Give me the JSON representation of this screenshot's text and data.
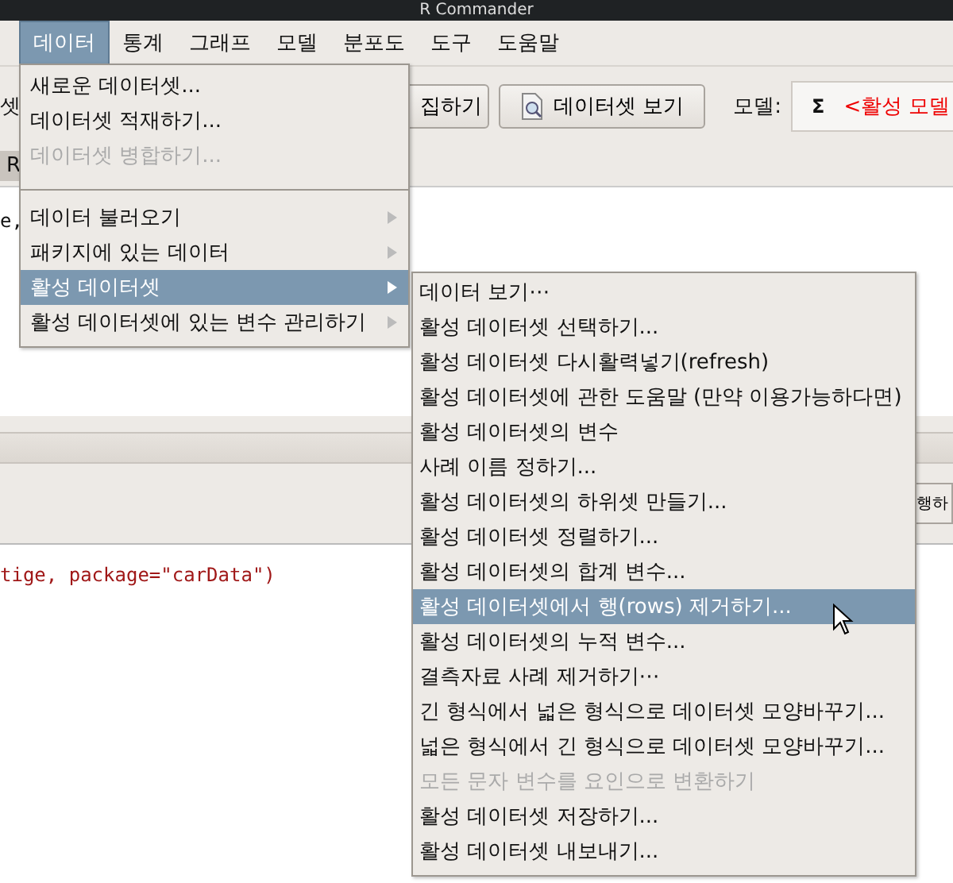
{
  "window": {
    "title": "R Commander"
  },
  "menubar": [
    {
      "label": "데이터",
      "selected": true
    },
    {
      "label": "통계",
      "selected": false
    },
    {
      "label": "그래프",
      "selected": false
    },
    {
      "label": "모델",
      "selected": false
    },
    {
      "label": "분포도",
      "selected": false
    },
    {
      "label": "도구",
      "selected": false
    },
    {
      "label": "도움말",
      "selected": false
    }
  ],
  "toolbar": {
    "left_label": "셋",
    "edit_button": "집하기",
    "view_button": "데이터셋 보기",
    "model_label": "모델:",
    "model_symbol": "Σ",
    "model_value": "<활성 모델"
  },
  "script_tab": "R",
  "script_lines": [
    "e,"
  ],
  "run_button": "행하",
  "output_lines": [
    "tige, package=\"carData\")"
  ],
  "data_menu": [
    {
      "kind": "item",
      "label": "새로운 데이터셋...",
      "disabled": false,
      "submenu": false,
      "selected": false
    },
    {
      "kind": "item",
      "label": "데이터셋 적재하기...",
      "disabled": false,
      "submenu": false,
      "selected": false
    },
    {
      "kind": "item",
      "label": "데이터셋 병합하기...",
      "disabled": true,
      "submenu": false,
      "selected": false
    },
    {
      "kind": "separator"
    },
    {
      "kind": "item",
      "label": "데이터 불러오기",
      "disabled": false,
      "submenu": true,
      "selected": false
    },
    {
      "kind": "item",
      "label": "패키지에 있는 데이터",
      "disabled": false,
      "submenu": true,
      "selected": false
    },
    {
      "kind": "item",
      "label": "활성 데이터셋",
      "disabled": false,
      "submenu": true,
      "selected": true
    },
    {
      "kind": "item",
      "label": "활성 데이터셋에 있는 변수 관리하기",
      "disabled": false,
      "submenu": true,
      "selected": false
    }
  ],
  "active_dataset_menu": [
    {
      "label": "데이터 보기⋯",
      "disabled": false,
      "selected": false
    },
    {
      "label": "활성 데이터셋 선택하기...",
      "disabled": false,
      "selected": false
    },
    {
      "label": "활성 데이터셋 다시활력넣기(refresh)",
      "disabled": false,
      "selected": false
    },
    {
      "label": "활성 데이터셋에 관한 도움말 (만약 이용가능하다면)",
      "disabled": false,
      "selected": false
    },
    {
      "label": "활성 데이터셋의 변수",
      "disabled": false,
      "selected": false
    },
    {
      "label": "사례 이름 정하기...",
      "disabled": false,
      "selected": false
    },
    {
      "label": "활성 데이터셋의 하위셋 만들기...",
      "disabled": false,
      "selected": false
    },
    {
      "label": "활성 데이터셋 정렬하기...",
      "disabled": false,
      "selected": false
    },
    {
      "label": "활성 데이터셋의 합계 변수...",
      "disabled": false,
      "selected": false
    },
    {
      "label": "활성 데이터셋에서 행(rows) 제거하기...",
      "disabled": false,
      "selected": true
    },
    {
      "label": "활성 데이터셋의 누적 변수...",
      "disabled": false,
      "selected": false
    },
    {
      "label": "결측자료 사례 제거하기⋯",
      "disabled": false,
      "selected": false
    },
    {
      "label": "긴 형식에서 넓은 형식으로 데이터셋 모양바꾸기...",
      "disabled": false,
      "selected": false
    },
    {
      "label": "넓은 형식에서 긴 형식으로 데이터셋 모양바꾸기...",
      "disabled": false,
      "selected": false
    },
    {
      "label": "모든 문자 변수를 요인으로 변환하기",
      "disabled": true,
      "selected": false
    },
    {
      "label": "활성 데이터셋 저장하기...",
      "disabled": false,
      "selected": false
    },
    {
      "label": "활성 데이터셋 내보내기...",
      "disabled": false,
      "selected": false
    }
  ]
}
